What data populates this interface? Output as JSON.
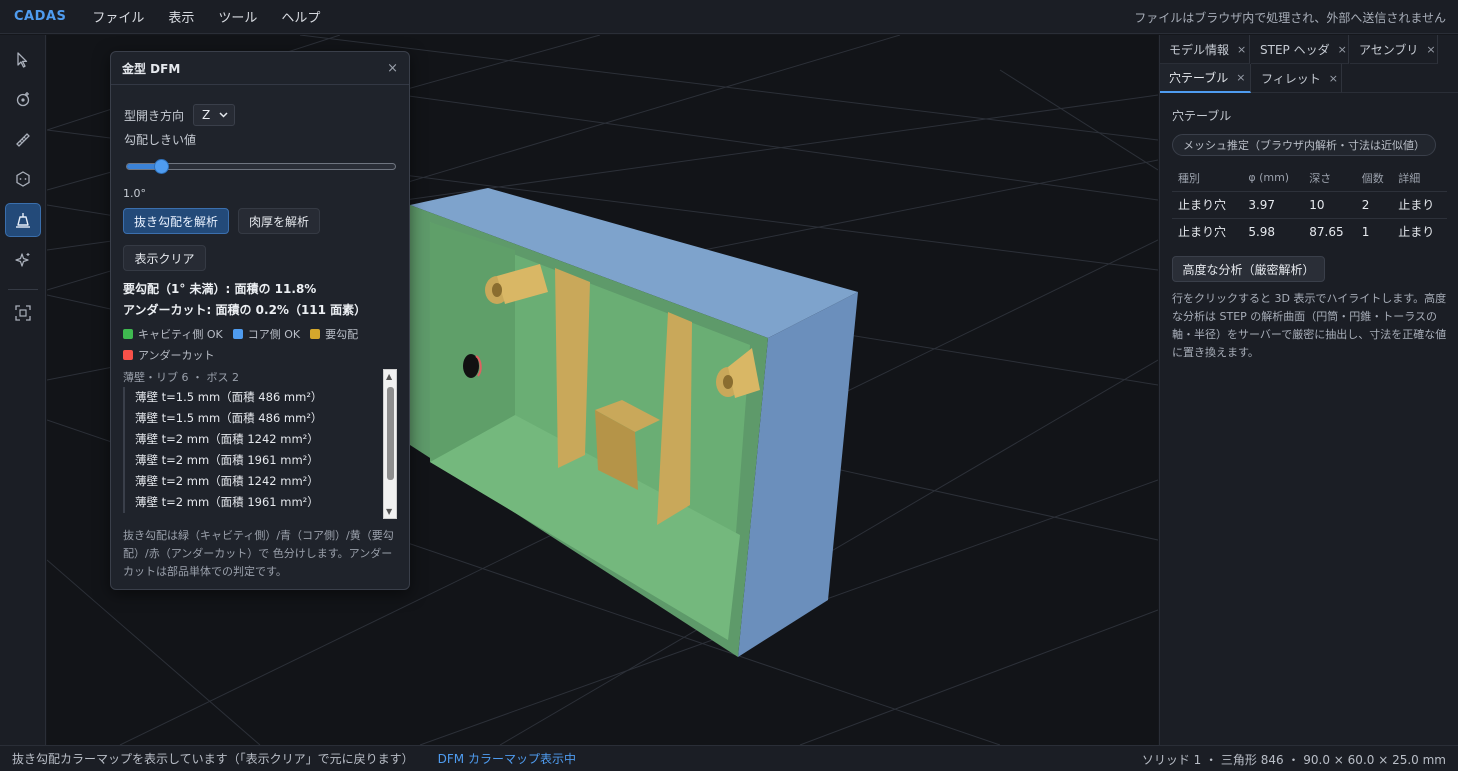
{
  "topbar": {
    "brand": "CADAS",
    "menu": [
      "ファイル",
      "表示",
      "ツール",
      "ヘルプ"
    ],
    "privacy_note": "ファイルはブラウザ内で処理され、外部へ送信されません"
  },
  "toolbar": {
    "tools": [
      "select-icon",
      "target-point-icon",
      "ruler-icon",
      "hexagon-icon",
      "mold-draft-icon",
      "sparkle-icon",
      "focus-frame-icon"
    ]
  },
  "dfm_panel": {
    "title": "金型 DFM",
    "close": "×",
    "mold_direction_label": "型開き方向",
    "mold_direction_value": "Z",
    "draft_threshold_label": "勾配しきい値",
    "draft_threshold_value": "1.0°",
    "slider_fraction": 0.11,
    "analyze_draft_button": "抜き勾配を解析",
    "analyze_thickness_button": "肉厚を解析",
    "clear_button": "表示クリア",
    "draft_required_stat": "要勾配（1° 未満）: 面積の 11.8%",
    "undercut_stat": "アンダーカット: 面積の 0.2%（111 面素）",
    "legend": [
      {
        "label": "キャビティ側 OK",
        "color": "#3fb950"
      },
      {
        "label": "コア側 OK",
        "color": "#4f9cf0"
      },
      {
        "label": "要勾配",
        "color": "#d4a72c"
      },
      {
        "label": "アンダーカット",
        "color": "#f85149"
      }
    ],
    "list_header": "薄壁・リブ 6 ・ ボス 2",
    "list_items": [
      "薄壁 t=1.5 mm（面積 486 mm²）",
      "薄壁 t=1.5 mm（面積 486 mm²）",
      "薄壁 t=2 mm（面積 1242 mm²）",
      "薄壁 t=2 mm（面積 1961 mm²）",
      "薄壁 t=2 mm（面積 1242 mm²）",
      "薄壁 t=2 mm（面積 1961 mm²）"
    ],
    "note": "抜き勾配は緑（キャビティ側）/青（コア側）/黄（要勾配）/赤（アンダーカット）で 色分けします。アンダーカットは部品単体での判定です。"
  },
  "right_panel": {
    "tabs": [
      "モデル情報",
      "STEP ヘッダ",
      "アセンブリ",
      "穴テーブル",
      "フィレット"
    ],
    "active_tab": "穴テーブル",
    "title": "穴テーブル",
    "chip": "メッシュ推定（ブラウザ内解析・寸法は近似値）",
    "columns": [
      "種別",
      "φ (mm)",
      "深さ",
      "個数",
      "詳細"
    ],
    "rows": [
      [
        "止まり穴",
        "3.97",
        "10",
        "2",
        "止まり"
      ],
      [
        "止まり穴",
        "5.98",
        "87.65",
        "1",
        "止まり"
      ]
    ],
    "advanced_button": "高度な分析（厳密解析）",
    "note": "行をクリックすると 3D 表示でハイライトします。高度な分析は STEP の解析曲面（円筒・円錐・トーラスの軸・半径）をサーバーで厳密に抽出し、寸法を正確な値に置き換えます。"
  },
  "statusbar": {
    "message": "抜き勾配カラーマップを表示しています（「表示クリア」で元に戻ります）",
    "mode": "DFM カラーマップ表示中",
    "info": "ソリッド 1 ・ 三角形 846 ・ 90.0 × 60.0 × 25.0 mm"
  },
  "colors": {
    "accent": "#4f9cf0",
    "cavity_green": "#6aae74",
    "core_blue": "#7ea3cc",
    "draft_yellow": "#c9a85a"
  }
}
